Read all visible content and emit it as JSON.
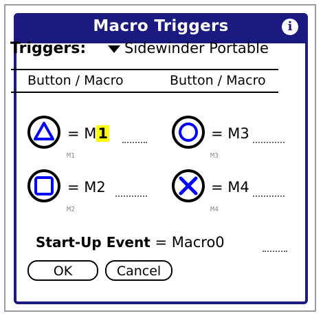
{
  "dialog": {
    "title": "Macro Triggers",
    "info_icon": "info-icon",
    "title_color": "#1a1a80"
  },
  "triggers": {
    "label": "Triggers:",
    "selected": "Sidewinder Portable",
    "arrow_icon": "triangle-down-icon"
  },
  "columns": {
    "left_header": "Button / Macro",
    "right_header": "Button / Macro"
  },
  "buttons": [
    {
      "icon": "triangle-icon",
      "sub": "M1",
      "eq": "= M",
      "value": "1"
    },
    {
      "icon": "circle-icon",
      "sub": "M3",
      "eq": "= M3",
      "value": ""
    },
    {
      "icon": "square-icon",
      "sub": "M2",
      "eq": "= M2",
      "value": ""
    },
    {
      "icon": "x-icon",
      "sub": "M4",
      "eq": "= M4",
      "value": ""
    }
  ],
  "startup": {
    "label": "Start-Up Event",
    "eq": "= Macro",
    "value": "0"
  },
  "actions": {
    "ok": "OK",
    "cancel": "Cancel"
  },
  "colors": {
    "icon_blue": "#0000ff",
    "highlight": "#ffff00"
  }
}
